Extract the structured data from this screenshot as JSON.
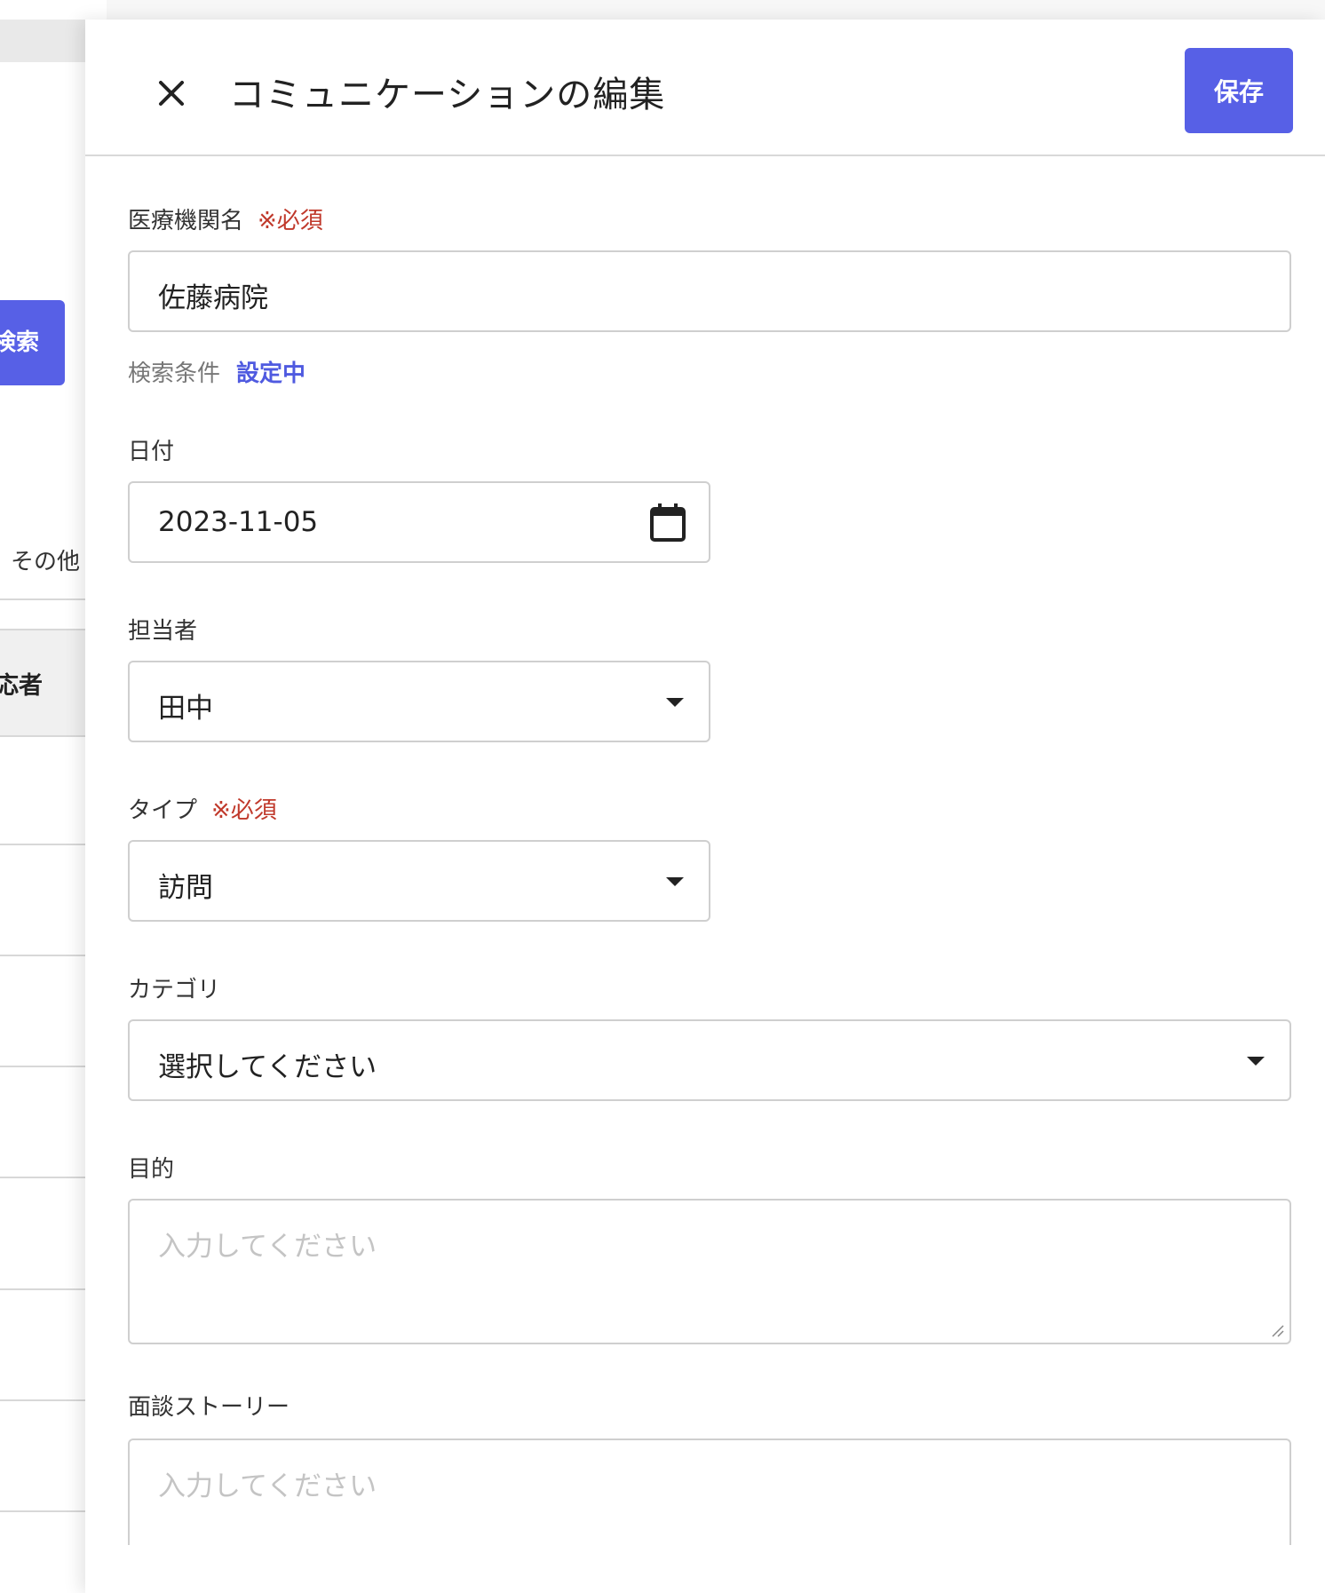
{
  "background": {
    "search_button_label": "検索",
    "filter_label": "その他",
    "table_header_label": "応者"
  },
  "panel": {
    "title": "コミュニケーションの編集",
    "save_label": "保存",
    "close_icon": "close-icon"
  },
  "form": {
    "institution": {
      "label": "医療機関名",
      "required": "※必須",
      "value": "佐藤病院",
      "search_condition_label": "検索条件",
      "search_condition_status": "設定中"
    },
    "date": {
      "label": "日付",
      "value": "2023-11-05",
      "icon": "calendar-icon"
    },
    "assignee": {
      "label": "担当者",
      "value": "田中",
      "icon": "chevron-down-icon"
    },
    "type": {
      "label": "タイプ",
      "required": "※必須",
      "value": "訪問",
      "icon": "chevron-down-icon"
    },
    "category": {
      "label": "カテゴリ",
      "value": "選択してください",
      "icon": "chevron-down-icon"
    },
    "purpose": {
      "label": "目的",
      "placeholder": "入力してください"
    },
    "story": {
      "label": "面談ストーリー",
      "placeholder": "入力してください"
    }
  },
  "colors": {
    "accent": "#5760e6",
    "required": "#c0392b",
    "link": "#4f5ae0"
  }
}
